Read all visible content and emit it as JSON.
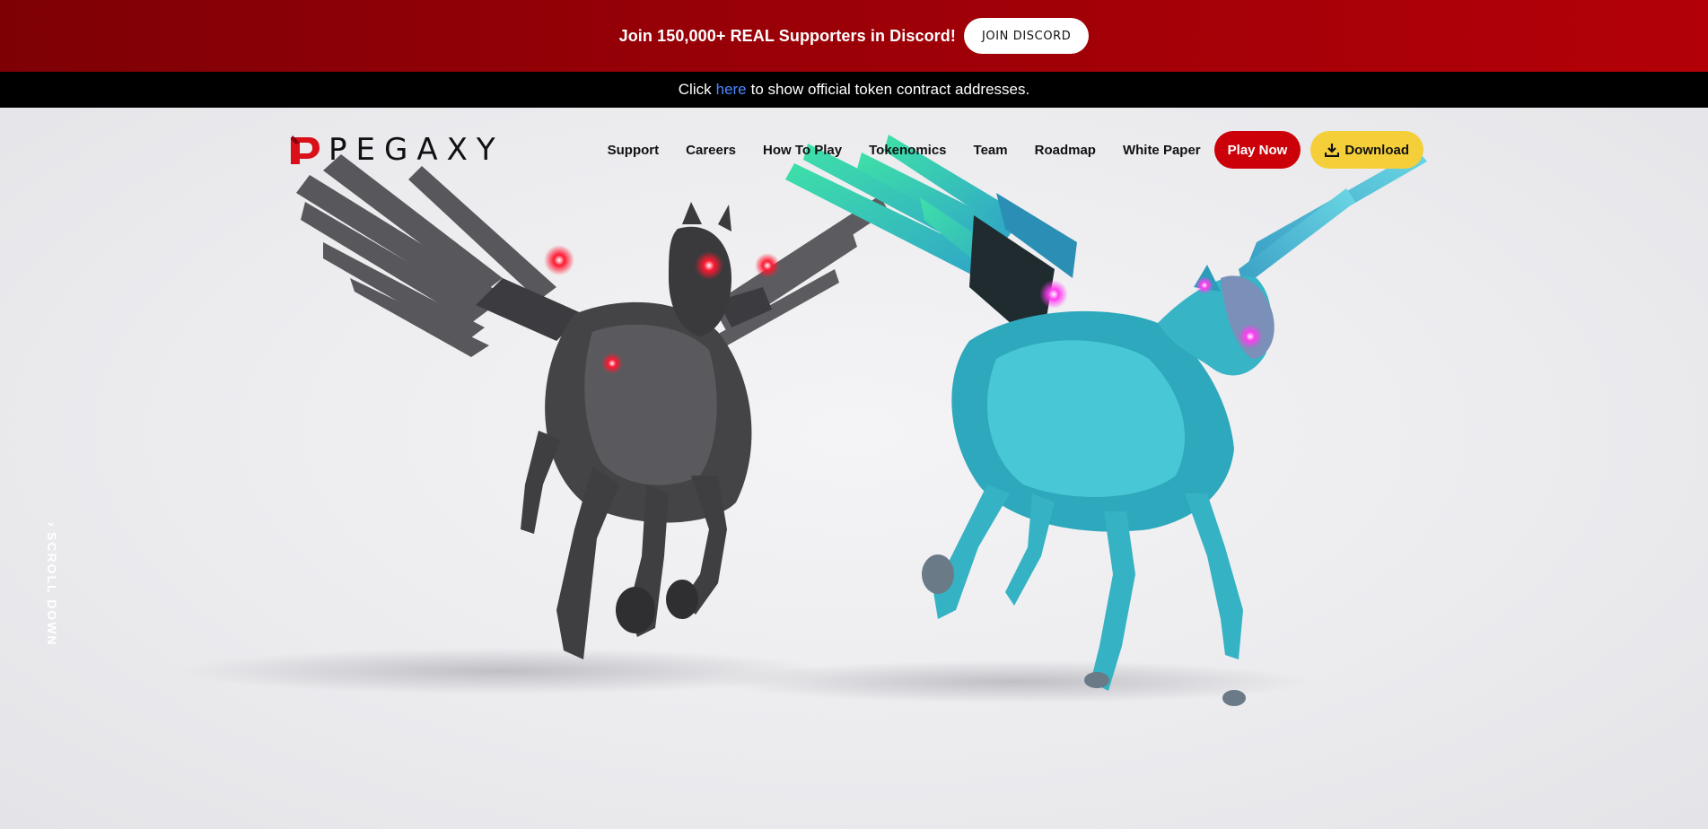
{
  "promo": {
    "text": "Join 150,000+ REAL Supporters in Discord!",
    "button_label": "JOIN DISCORD"
  },
  "notice": {
    "before": "Click",
    "link": "here",
    "after": "to show official token contract addresses."
  },
  "brand": {
    "name": "PEGAXY"
  },
  "nav": {
    "items": [
      "Support",
      "Careers",
      "How To Play",
      "Tokenomics",
      "Team",
      "Roadmap",
      "White Paper"
    ],
    "play_label": "Play Now",
    "download_label": "Download"
  },
  "hero": {
    "scroll_label": "SCROLL DOWN",
    "image_name": "two-robotic-pegasus-running"
  },
  "colors": {
    "banner": "#9a0007",
    "play_button": "#cc0008",
    "download_button": "#f5cf3a",
    "link": "#4a86ff",
    "pega_dark": "#3a3a3c",
    "pega_cyan": "#36c0cf",
    "eye_red": "#ff1830",
    "eye_pink": "#ff3cf0",
    "wing_green": "#3ee0a8"
  }
}
